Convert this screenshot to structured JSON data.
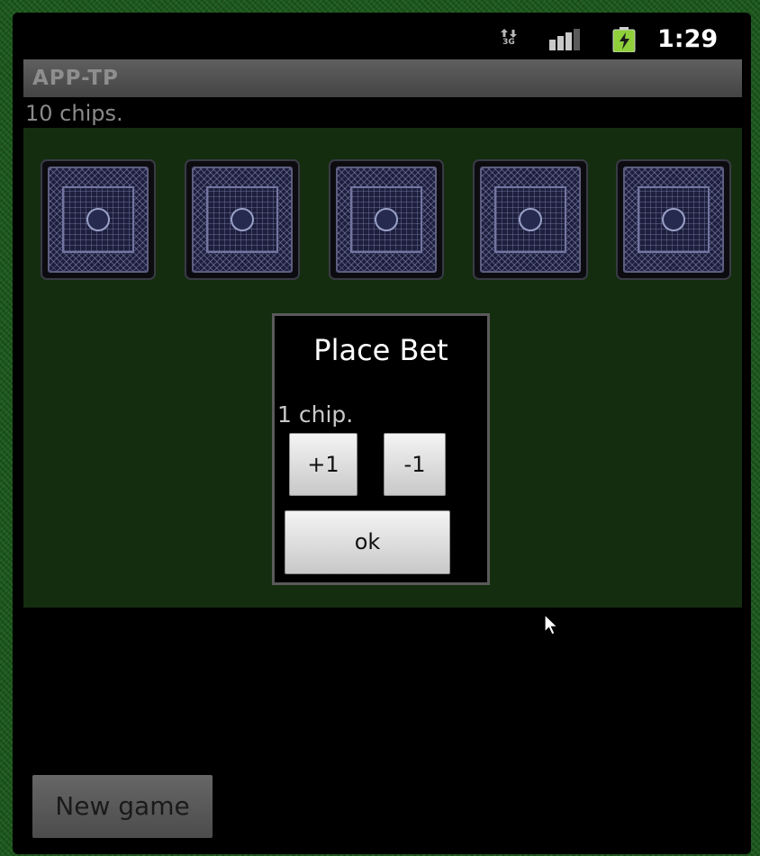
{
  "status_bar": {
    "network": "3G",
    "time": "1:29",
    "icons": [
      "data-arrows-3g-icon",
      "signal-strength-icon",
      "battery-charging-icon"
    ]
  },
  "app": {
    "title": "APP-TP",
    "chips_label": "10 chips."
  },
  "table": {
    "background": "#142d0f",
    "cards": [
      {
        "face": "down"
      },
      {
        "face": "down"
      },
      {
        "face": "down"
      },
      {
        "face": "down"
      },
      {
        "face": "down"
      }
    ]
  },
  "bet_dialog": {
    "title": "Place Bet",
    "amount_label": "1 chip.",
    "increment_label": "+1",
    "decrement_label": "-1",
    "ok_label": "ok"
  },
  "footer": {
    "new_game_label": "New game"
  },
  "colors": {
    "background_pattern": "#1f5a1f",
    "battery": "#8ecf3a"
  }
}
